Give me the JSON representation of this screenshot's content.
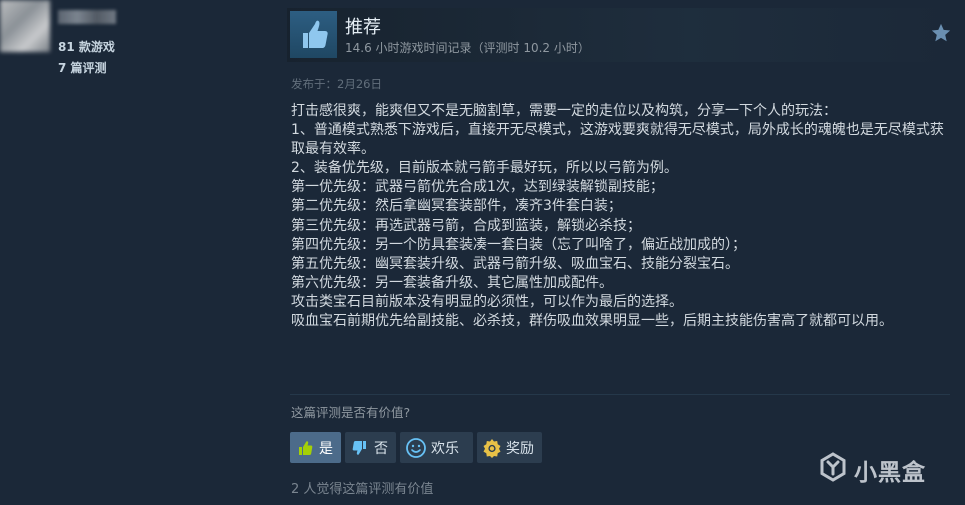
{
  "reviewer": {
    "games_count": "81 款游戏",
    "reviews_count": "7 篇评测"
  },
  "review": {
    "verdict": "推荐",
    "playtime": "14.6 小时游戏时间记录（评测时 10.2 小时）",
    "posted": "发布于：2月26日",
    "body": [
      "打击感很爽，能爽但又不是无脑割草，需要一定的走位以及构筑，分享一下个人的玩法：",
      "1、普通模式熟悉下游戏后，直接开无尽模式，这游戏要爽就得无尽模式，局外成长的魂魄也是无尽模式获取最有效率。",
      "2、装备优先级，目前版本就弓箭手最好玩，所以以弓箭为例。",
      "第一优先级：武器弓箭优先合成1次，达到绿装解锁副技能；",
      "第二优先级：然后拿幽冥套装部件，凑齐3件套白装；",
      "第三优先级：再选武器弓箭，合成到蓝装，解锁必杀技；",
      "第四优先级：另一个防具套装凑一套白装（忘了叫啥了，偏近战加成的）；",
      "第五优先级：幽冥套装升级、武器弓箭升级、吸血宝石、技能分裂宝石。",
      "第六优先级：另一套装备升级、其它属性加成配件。",
      "攻击类宝石目前版本没有明显的必须性，可以作为最后的选择。",
      "吸血宝石前期优先给副技能、必杀技，群伤吸血效果明显一些，后期主技能伤害高了就都可以用。"
    ]
  },
  "feedback": {
    "question": "这篇评测是否有价值?",
    "yes_label": "是",
    "no_label": "否",
    "funny_label": "欢乐",
    "award_label": "奖励",
    "helpful_count": "2 人觉得这篇评测有价值"
  },
  "watermark": {
    "text": "小黑盒"
  },
  "colors": {
    "background": "#1b2838",
    "thumb_box": "#2d5e82",
    "active_button": "#4c6b8a",
    "award_gold": "#e8c147"
  }
}
